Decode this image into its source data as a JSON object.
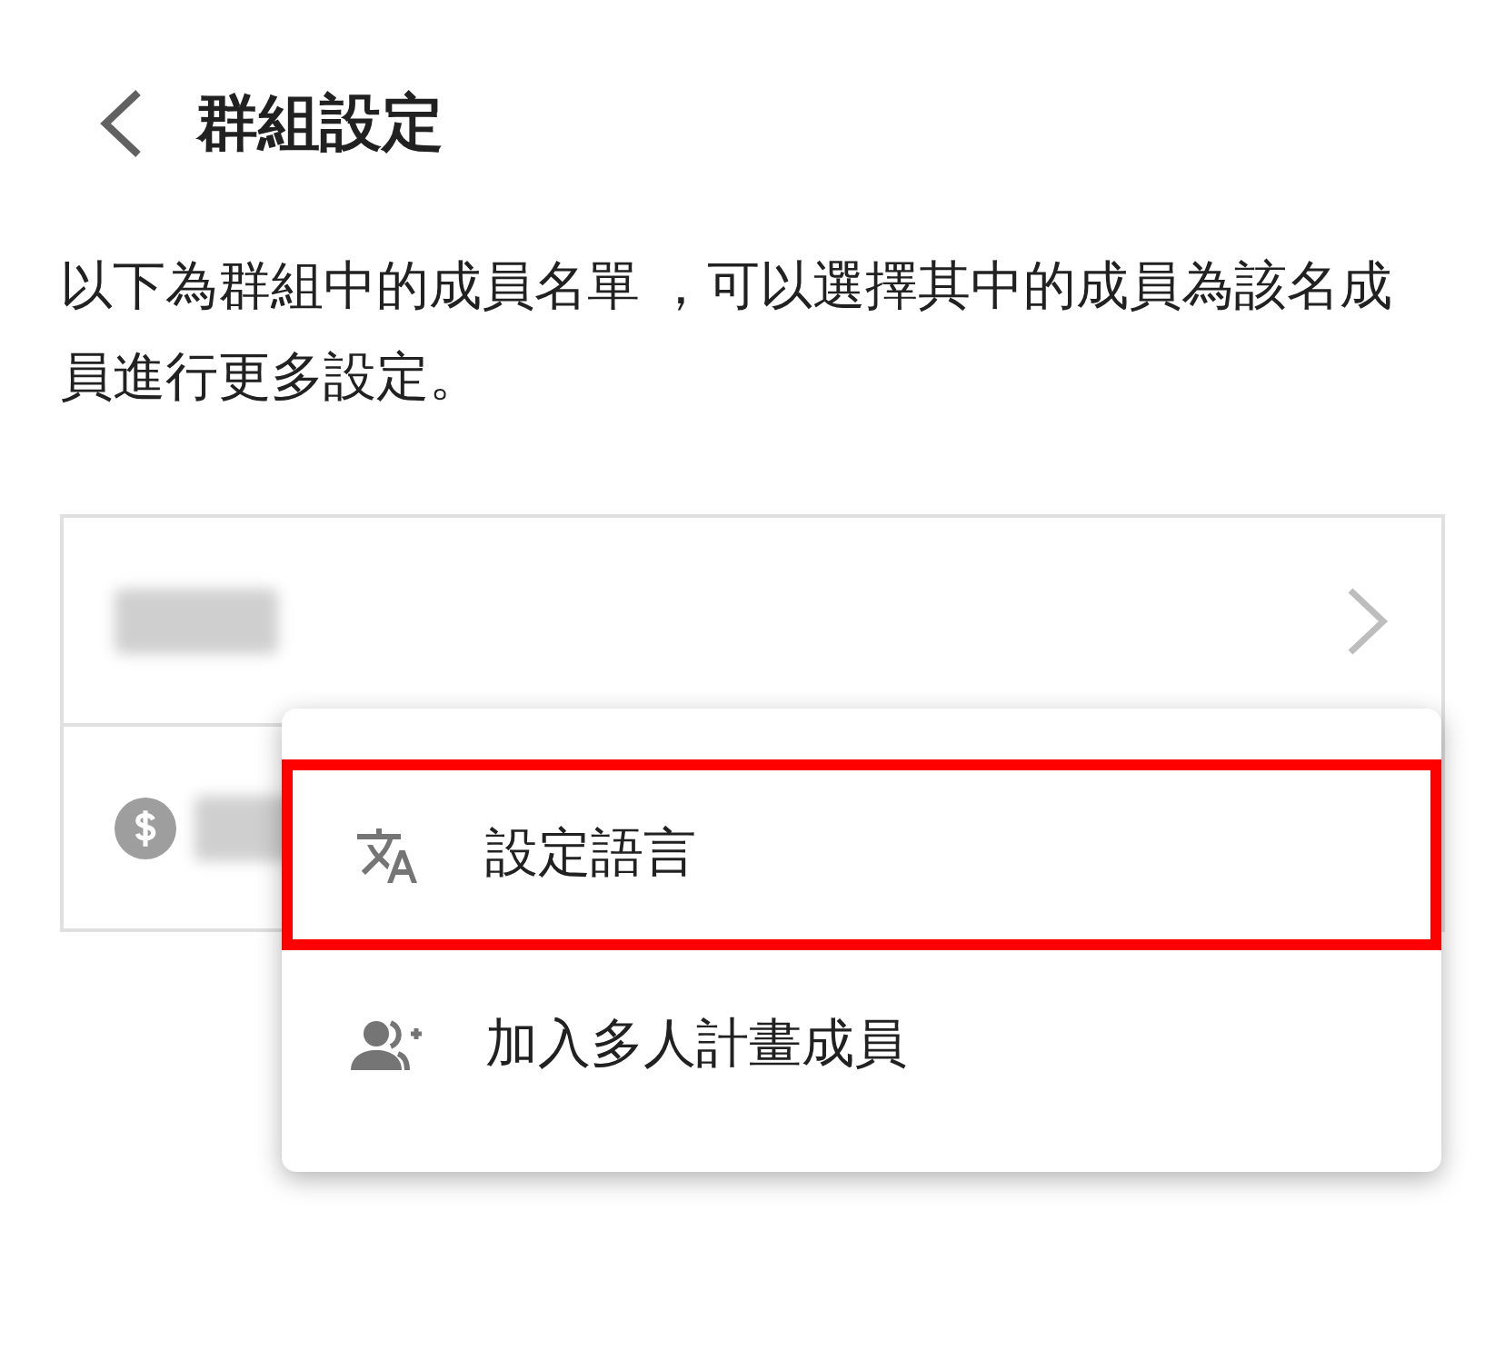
{
  "header": {
    "title": "群組設定"
  },
  "description": "以下為群組中的成員名單 ，可以選擇其中的成員為該名成員進行更多設定。",
  "members": [
    {
      "kind": "plain"
    },
    {
      "kind": "paid"
    }
  ],
  "menu": {
    "items": [
      {
        "kind": "language",
        "label": "設定語言",
        "highlighted": true
      },
      {
        "kind": "add-member",
        "label": "加入多人計畫成員",
        "highlighted": false
      }
    ]
  }
}
